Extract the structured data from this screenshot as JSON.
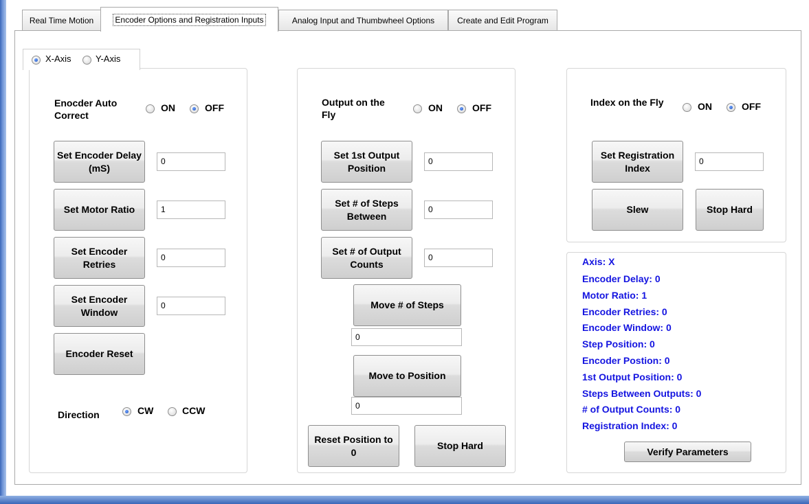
{
  "tabs": [
    {
      "label": "Real Time Motion",
      "active": false
    },
    {
      "label": "Encoder Options and Registration Inputs",
      "active": true
    },
    {
      "label": "Analog Input and Thumbwheel Options",
      "active": false
    },
    {
      "label": "Create and Edit Program",
      "active": false
    }
  ],
  "axis": {
    "x_label": "X-Axis",
    "y_label": "Y-Axis",
    "selected": "X-Axis"
  },
  "encoder": {
    "auto_correct_label": "Enocder Auto Correct",
    "on_label": "ON",
    "off_label": "OFF",
    "selected": "OFF",
    "delay_button": "Set Encoder Delay (mS)",
    "delay_value": "0",
    "motor_ratio_button": "Set Motor Ratio",
    "motor_ratio_value": "1",
    "retries_button": "Set Encoder Retries",
    "retries_value": "0",
    "window_button": "Set Encoder Window",
    "window_value": "0",
    "reset_button": "Encoder Reset",
    "direction_label": "Direction",
    "cw_label": "CW",
    "ccw_label": "CCW",
    "direction_selected": "CW"
  },
  "output": {
    "fly_label": "Output on the Fly",
    "on_label": "ON",
    "off_label": "OFF",
    "selected": "OFF",
    "first_position_button": "Set 1st Output Position",
    "first_position_value": "0",
    "steps_between_button": "Set # of Steps Between",
    "steps_between_value": "0",
    "output_counts_button": "Set # of Output Counts",
    "output_counts_value": "0",
    "move_steps_button": "Move # of Steps",
    "move_steps_value": "0",
    "move_position_button": "Move to Position",
    "move_position_value": "0",
    "reset_position_button": "Reset Position to 0",
    "stop_hard_button": "Stop Hard"
  },
  "index": {
    "fly_label": "Index on the Fly",
    "on_label": "ON",
    "off_label": "OFF",
    "selected": "OFF",
    "registration_button": "Set Registration Index",
    "registration_value": "0",
    "slew_button": "Slew",
    "stop_hard_button": "Stop Hard"
  },
  "status": {
    "lines": [
      "Axis: X",
      "Encoder Delay: 0",
      "Motor Ratio: 1",
      "Encoder Retries: 0",
      "Encoder Window: 0",
      "Step Position: 0",
      "Encoder Postion: 0",
      "1st Output Position: 0",
      "Steps Between Outputs: 0",
      "# of Output Counts: 0",
      "Registration Index: 0"
    ],
    "verify_button": "Verify Parameters",
    "text_color": "#1414e0"
  }
}
